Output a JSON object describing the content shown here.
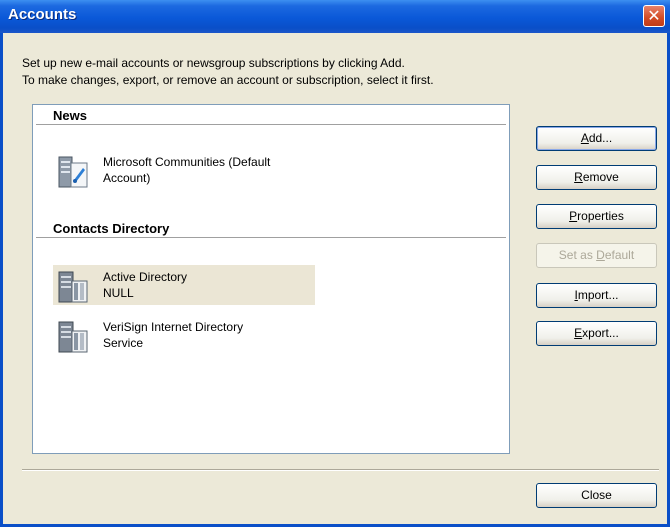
{
  "window": {
    "title": "Accounts",
    "close_glyph": "✕"
  },
  "instructions": {
    "line1": "Set up new e-mail accounts or newsgroup subscriptions by clicking Add.",
    "line2": "To make changes, export, or remove an account or subscription, select it first."
  },
  "accounts_list": {
    "groups": [
      {
        "header": "News",
        "items": [
          {
            "line1": "Microsoft Communities (Default",
            "line2": "Account)",
            "icon": "news-server-icon",
            "selected": false
          }
        ]
      },
      {
        "header": "Contacts Directory",
        "items": [
          {
            "line1": "Active Directory",
            "line2": "NULL",
            "icon": "directory-server-icon",
            "selected": true
          },
          {
            "line1": "VeriSign Internet Directory",
            "line2": "Service",
            "icon": "directory-server-icon",
            "selected": false
          }
        ]
      }
    ]
  },
  "buttons": {
    "add": {
      "pre": "",
      "key": "A",
      "post": "dd..."
    },
    "remove": {
      "pre": "",
      "key": "R",
      "post": "emove"
    },
    "properties": {
      "pre": "",
      "key": "P",
      "post": "roperties"
    },
    "set_default": {
      "pre": "Set as ",
      "key": "D",
      "post": "efault",
      "disabled": true
    },
    "import": {
      "pre": "",
      "key": "I",
      "post": "mport..."
    },
    "export": {
      "pre": "",
      "key": "E",
      "post": "xport..."
    },
    "close": "Close"
  },
  "colors": {
    "titlebar": "#0a58d8",
    "close_button": "#d24b25",
    "selection": "#ebe6d5",
    "dialog_face": "#ece9d8"
  }
}
